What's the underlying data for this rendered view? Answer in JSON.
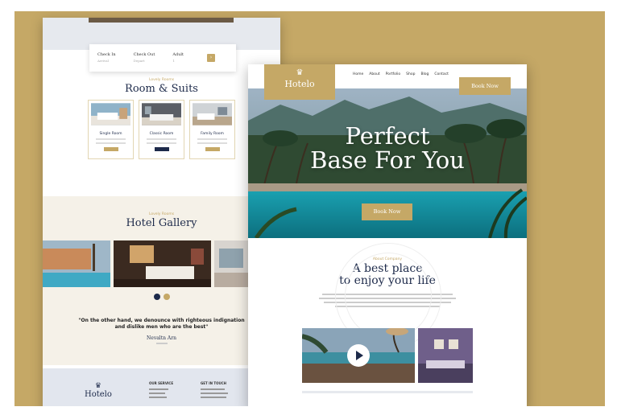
{
  "brand": {
    "name": "Hotelo",
    "accent": "#c5a866",
    "navy": "#1d2a4a"
  },
  "back": {
    "booking": {
      "fields": [
        {
          "label": "Check In",
          "sub": "Arrival"
        },
        {
          "label": "Check Out",
          "sub": "Depart"
        },
        {
          "label": "Adult",
          "sub": "1"
        }
      ]
    },
    "rooms": {
      "eyebrow": "Lovely Rooms",
      "title": "Room & Suits",
      "cards": [
        {
          "name": "Single Room"
        },
        {
          "name": "Classic Room"
        },
        {
          "name": "Family Room"
        }
      ]
    },
    "gallery": {
      "eyebrow": "Lovely Rooms",
      "title": "Hotel Gallery"
    },
    "testimonial": {
      "quote": "\"On the other hand, we denounce with righteous indignation and dislike men who are the best\"",
      "name": "Nevaltn Arn"
    },
    "footer": {
      "logo": "Hotelo",
      "col1_title": "OUR SERVICE",
      "col2_title": "GET IN TOUCH"
    }
  },
  "front": {
    "nav": [
      "Home",
      "About",
      "Portfolio",
      "Shop",
      "Blog",
      "Contact"
    ],
    "book_label": "Book Now",
    "hero": {
      "title_line1": "Perfect",
      "title_line2": "Base For You",
      "button": "Book Now"
    },
    "about": {
      "eyebrow": "About Company",
      "title_line1": "A best place",
      "title_line2": "to enjoy your life"
    }
  }
}
